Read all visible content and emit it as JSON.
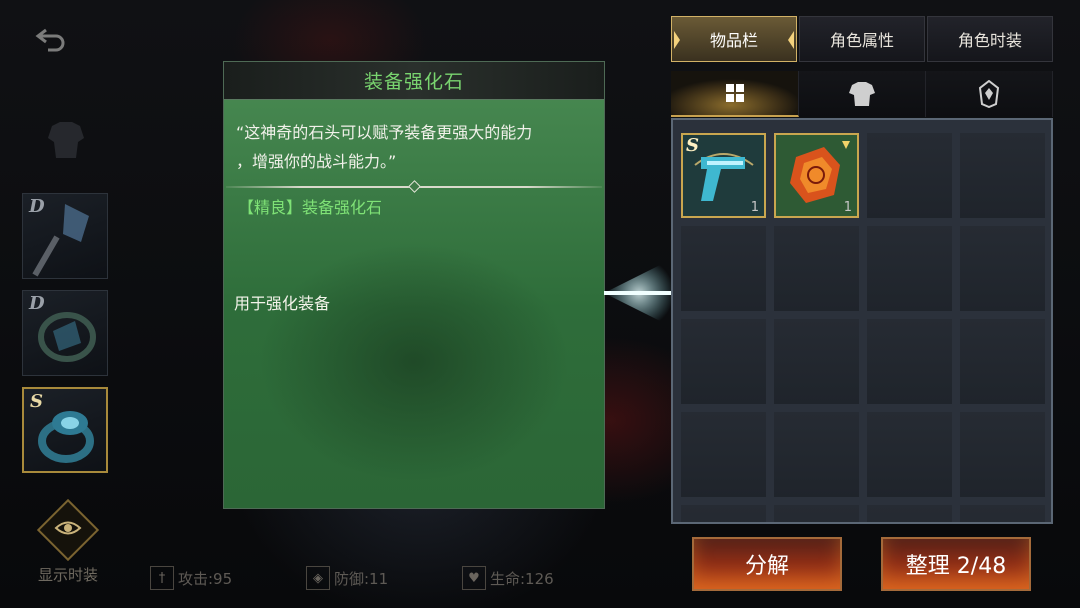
{
  "tooltip": {
    "title": "装备强化石",
    "flavor_line1": "“这神奇的石头可以赋予装备更强大的能力",
    "flavor_line2": "，增强你的战斗能力。”",
    "item_name": "【精良】装备强化石",
    "description": "用于强化装备"
  },
  "left": {
    "slots": [
      {
        "grade": "D",
        "icon": "axe-icon"
      },
      {
        "grade": "D",
        "icon": "cloak-icon"
      },
      {
        "grade": "S",
        "icon": "ring-icon"
      }
    ],
    "show_costume_label": "显示时装"
  },
  "stats": {
    "attack": "攻击:95",
    "defense": "防御:11",
    "health": "生命:126"
  },
  "tabs": [
    "物品栏",
    "角色属性",
    "角色时装"
  ],
  "active_tab": "物品栏",
  "inventory": {
    "items": [
      {
        "name": "S-grade blaster",
        "grade": "S",
        "qty": "1",
        "icon": "pistol-icon"
      },
      {
        "name": "enhancement stone",
        "grade": "",
        "qty": "1",
        "icon": "enhance-stone-icon"
      }
    ],
    "capacity": "2/48"
  },
  "buttons": {
    "decompose": "分解",
    "sort": "整理 2/48"
  },
  "colors": {
    "tooltip_green": "#3a7a45",
    "title_green": "#79d46f",
    "gold_accent": "#c9a64f",
    "button_orange": "#c2491a"
  }
}
